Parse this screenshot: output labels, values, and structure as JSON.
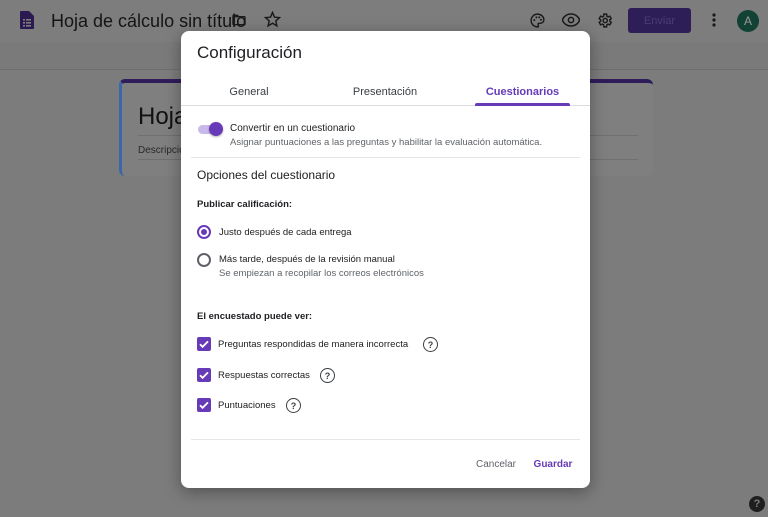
{
  "app": {
    "doc_title": "Hoja de cálculo sin título",
    "send_label": "Enviar",
    "avatar_initial": "A",
    "form_title": "Hoja",
    "form_description": "Descripció"
  },
  "dialog": {
    "title": "Configuración",
    "tabs": [
      {
        "label": "General",
        "active": false
      },
      {
        "label": "Presentación",
        "active": false
      },
      {
        "label": "Cuestionarios",
        "active": true
      }
    ],
    "quiz_toggle": {
      "label": "Convertir en un cuestionario",
      "description": "Asignar puntuaciones a las preguntas y habilitar la evaluación automática.",
      "on": true
    },
    "section_title": "Opciones del cuestionario",
    "publish": {
      "label": "Publicar calificación:",
      "options": [
        {
          "label": "Justo después de cada entrega",
          "sub": "",
          "selected": true
        },
        {
          "label": "Más tarde, después de la revisión manual",
          "sub": "Se empiezan a recopilar los correos electrónicos",
          "selected": false
        }
      ]
    },
    "respondent": {
      "label": "El encuestado puede ver:",
      "options": [
        {
          "label": "Preguntas respondidas de manera incorrecta",
          "checked": true
        },
        {
          "label": "Respuestas correctas",
          "checked": true
        },
        {
          "label": "Puntuaciones",
          "checked": true
        }
      ]
    },
    "buttons": {
      "cancel": "Cancelar",
      "save": "Guardar"
    }
  },
  "colors": {
    "accent": "#673ab7",
    "overlay": "#7c7c7c"
  },
  "icons": [
    "doc-icon",
    "folder-icon",
    "star-icon",
    "palette-icon",
    "eye-icon",
    "gear-icon",
    "more-vert-icon",
    "help-icon"
  ]
}
